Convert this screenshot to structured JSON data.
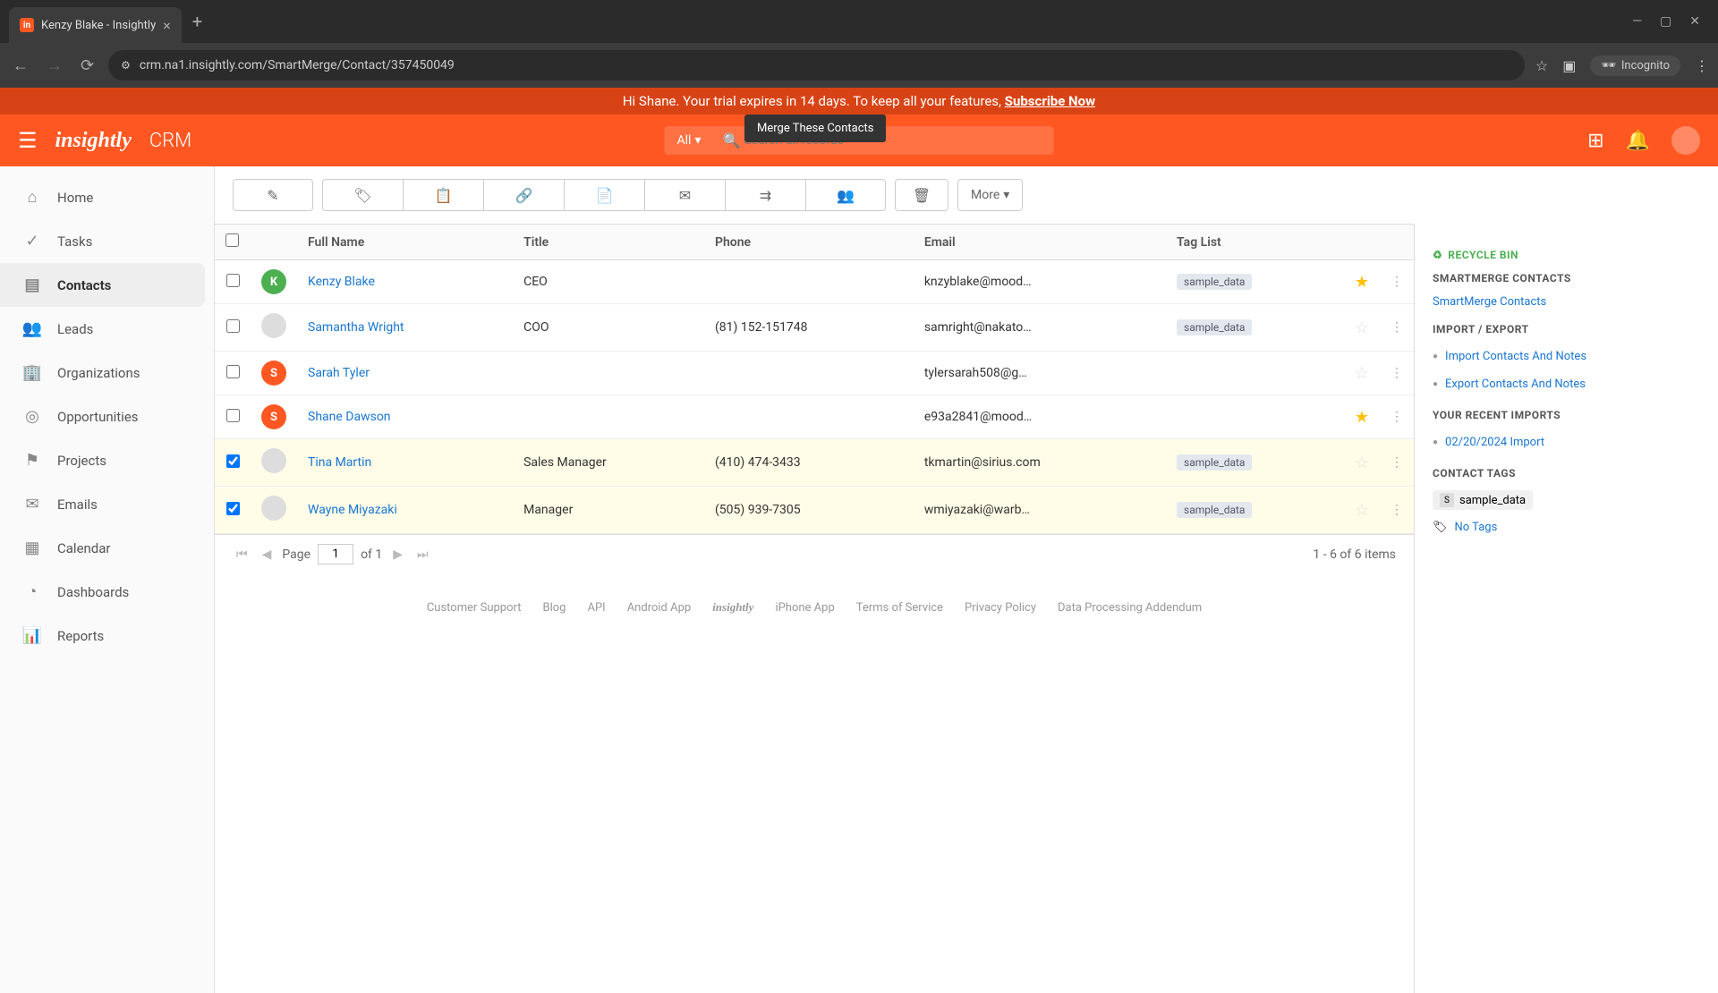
{
  "browser": {
    "tab_title": "Kenzy Blake - Insightly",
    "url": "crm.na1.insightly.com/SmartMerge/Contact/357450049",
    "incognito_label": "Incognito"
  },
  "trial_banner": {
    "text": "Hi Shane. Your trial expires in 14 days. To keep all your features, ",
    "cta": "Subscribe Now"
  },
  "header": {
    "logo": "insightly",
    "app": "CRM",
    "search_scope": "All",
    "search_placeholder": "Search all records"
  },
  "tooltip": "Merge These Contacts",
  "sidebar": {
    "items": [
      {
        "icon": "⌂",
        "label": "Home"
      },
      {
        "icon": "✓",
        "label": "Tasks"
      },
      {
        "icon": "▤",
        "label": "Contacts",
        "active": true
      },
      {
        "icon": "👥",
        "label": "Leads"
      },
      {
        "icon": "🏢",
        "label": "Organizations"
      },
      {
        "icon": "◎",
        "label": "Opportunities"
      },
      {
        "icon": "⚑",
        "label": "Projects"
      },
      {
        "icon": "✉",
        "label": "Emails"
      },
      {
        "icon": "▦",
        "label": "Calendar"
      },
      {
        "icon": "◔",
        "label": "Dashboards"
      },
      {
        "icon": "📊",
        "label": "Reports"
      }
    ]
  },
  "toolbar": {
    "more_label": "More"
  },
  "table": {
    "columns": [
      "Full Name",
      "Title",
      "Phone",
      "Email",
      "Tag List"
    ],
    "rows": [
      {
        "checked": false,
        "avatar": "K",
        "avatar_class": "green",
        "name": "Kenzy Blake",
        "title": "CEO",
        "phone": "",
        "email": "knzyblake@mood…",
        "tag": "sample_data",
        "starred": true
      },
      {
        "checked": false,
        "avatar": "",
        "avatar_class": "photo",
        "name": "Samantha Wright",
        "title": "COO",
        "phone": "(81) 152-151748",
        "email": "samright@nakato…",
        "tag": "sample_data",
        "starred": false
      },
      {
        "checked": false,
        "avatar": "S",
        "avatar_class": "orange",
        "name": "Sarah Tyler",
        "title": "",
        "phone": "",
        "email": "tylersarah508@g…",
        "tag": "",
        "starred": false
      },
      {
        "checked": false,
        "avatar": "S",
        "avatar_class": "orange",
        "name": "Shane Dawson",
        "title": "",
        "phone": "",
        "email": "e93a2841@mood…",
        "tag": "",
        "starred": true
      },
      {
        "checked": true,
        "avatar": "",
        "avatar_class": "photo",
        "name": "Tina Martin",
        "title": "Sales Manager",
        "phone": "(410) 474-3433",
        "email": "tkmartin@sirius.com",
        "tag": "sample_data",
        "starred": false
      },
      {
        "checked": true,
        "avatar": "",
        "avatar_class": "photo",
        "name": "Wayne Miyazaki",
        "title": "Manager",
        "phone": "(505) 939-7305",
        "email": "wmiyazaki@warb…",
        "tag": "sample_data",
        "starred": false
      }
    ]
  },
  "pagination": {
    "page_label": "Page",
    "current": "1",
    "of_label": "of 1",
    "summary": "1 - 6 of 6 items"
  },
  "right_panel": {
    "recycle": "RECYCLE BIN",
    "smartmerge_heading": "SMARTMERGE CONTACTS",
    "smartmerge_link": "SmartMerge Contacts",
    "import_heading": "IMPORT / EXPORT",
    "import_link": "Import Contacts And Notes",
    "export_link": "Export Contacts And Notes",
    "recent_heading": "YOUR RECENT IMPORTS",
    "recent_link": "02/20/2024 Import",
    "tags_heading": "CONTACT TAGS",
    "tag_sample": "sample_data",
    "no_tags": "No Tags"
  },
  "footer": {
    "links": [
      "Customer Support",
      "Blog",
      "API",
      "Android App",
      "insightly",
      "iPhone App",
      "Terms of Service",
      "Privacy Policy",
      "Data Processing Addendum"
    ]
  }
}
